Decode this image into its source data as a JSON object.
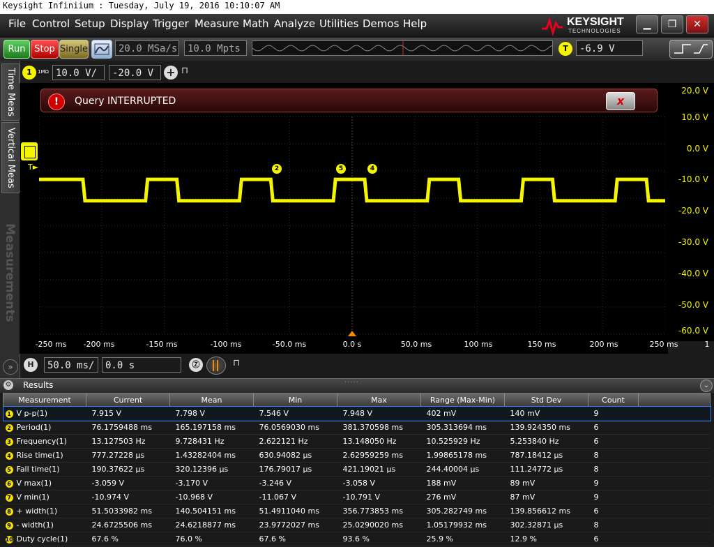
{
  "window": {
    "title": "Keysight Infiniium : Tuesday, July 19, 2016 10:10:07 AM"
  },
  "menu": [
    "File",
    "Control",
    "Setup",
    "Display",
    "Trigger",
    "Measure",
    "Math",
    "Analyze",
    "Utilities",
    "Demos",
    "Help"
  ],
  "brand": {
    "name": "KEYSIGHT",
    "sub": "TECHNOLOGIES",
    "color": "#e8001c"
  },
  "toolbar": {
    "run": "Run",
    "stop": "Stop",
    "single": "Single",
    "sample_rate": "20.0 MSa/s",
    "memory_depth": "10.0 Mpts",
    "trigger_badge": "T",
    "trigger_level": "-6.9 V"
  },
  "left_tabs": {
    "time_meas": "Time Meas",
    "vertical_meas": "Vertical Meas",
    "measurements": "Measurements"
  },
  "channel": {
    "number": "1",
    "impedance": "1MΩ",
    "scale": "10.0 V/",
    "offset": "-20.0 V",
    "color": "#f5f500"
  },
  "alert": {
    "message": "Query INTERRUPTED",
    "close": "x"
  },
  "plot": {
    "y_labels": [
      "20.0 V",
      "10.0 V",
      "0.0 V",
      "-10.0 V",
      "-20.0 V",
      "-30.0 V",
      "-40.0 V",
      "-50.0 V",
      "-60.0 V"
    ],
    "x_labels": [
      "-250 ms",
      "-200 ms",
      "-150 ms",
      "-100 ms",
      "-50.0 ms",
      "0.0 s",
      "50.0 ms",
      "100 ms",
      "150 ms",
      "200 ms",
      "250 ms"
    ],
    "x_axis_end": "1",
    "markers": [
      "2",
      "5",
      "4"
    ],
    "trigger_marker": "T",
    "signal_high_v": -3.1,
    "signal_low_v": -10.97,
    "waveform_transitions_ms": [
      -215,
      -165,
      -140,
      -90,
      -65,
      -15,
      10,
      60,
      85,
      135,
      160,
      210,
      235
    ]
  },
  "timebase": {
    "badge": "H",
    "scale": "50.0 ms/",
    "position": "0.0 s"
  },
  "results": {
    "title": "Results",
    "columns": [
      "Measurement",
      "Current",
      "Mean",
      "Min",
      "Max",
      "Range (Max-Min)",
      "Std Dev",
      "Count"
    ],
    "rows": [
      [
        "V p-p(1)",
        "7.915 V",
        "7.798 V",
        "7.546 V",
        "7.948 V",
        "402 mV",
        "140 mV",
        "9"
      ],
      [
        "Period(1)",
        "76.1759488 ms",
        "165.197158 ms",
        "76.0569030 ms",
        "381.370598 ms",
        "305.313694 ms",
        "139.924350 ms",
        "6"
      ],
      [
        "Frequency(1)",
        "13.127503 Hz",
        "9.728431 Hz",
        "2.622121 Hz",
        "13.148050 Hz",
        "10.525929 Hz",
        "5.253840 Hz",
        "6"
      ],
      [
        "Rise time(1)",
        "777.27228 µs",
        "1.43282404 ms",
        "630.94082 µs",
        "2.62959259 ms",
        "1.99865178 ms",
        "787.18412 µs",
        "8"
      ],
      [
        "Fall time(1)",
        "190.37622 µs",
        "320.12396 µs",
        "176.79017 µs",
        "421.19021 µs",
        "244.40004 µs",
        "111.24772 µs",
        "8"
      ],
      [
        "V max(1)",
        "-3.059 V",
        "-3.170 V",
        "-3.246 V",
        "-3.058 V",
        "188 mV",
        "89 mV",
        "9"
      ],
      [
        "V min(1)",
        "-10.974 V",
        "-10.968 V",
        "-11.067 V",
        "-10.791 V",
        "276 mV",
        "87 mV",
        "9"
      ],
      [
        "+ width(1)",
        "51.5033982 ms",
        "140.504151 ms",
        "51.4911040 ms",
        "356.773853 ms",
        "305.282749 ms",
        "139.856612 ms",
        "6"
      ],
      [
        "- width(1)",
        "24.6725506 ms",
        "24.6218877 ms",
        "23.9772027 ms",
        "25.0290020 ms",
        "1.05179932 ms",
        "302.32871 µs",
        "8"
      ],
      [
        "Duty cycle(1)",
        "67.6 %",
        "76.0 %",
        "67.6 %",
        "93.6 %",
        "25.9 %",
        "12.9 %",
        "6"
      ]
    ]
  }
}
